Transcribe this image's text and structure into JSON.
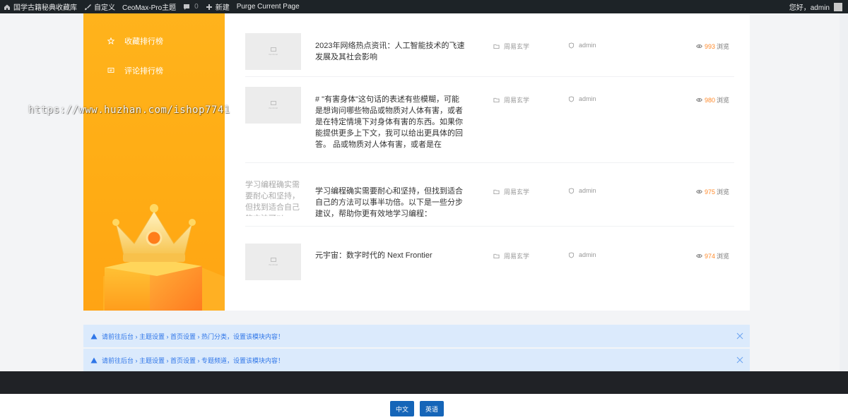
{
  "adminbar": {
    "site_name": "国学古籍秘典收藏库",
    "customize": "自定义",
    "theme": "CeoMax-Pro主题",
    "comments_count": "0",
    "new": "新建",
    "purge": "Purge Current Page",
    "greeting": "您好，admin"
  },
  "rank_panel": {
    "links": [
      "收藏排行榜",
      "评论排行榜"
    ]
  },
  "watermark": "https://www.huzhan.com/ishop7741",
  "posts": [
    {
      "title": "2023年网络热点资讯：人工智能技术的飞速发展及其社会影响",
      "category": "周易玄学",
      "author": "admin",
      "views": "993",
      "views_suffix": "浏览",
      "thumb_label": "thumbnail"
    },
    {
      "title": "# \"有害身体\"这句话的表述有些模糊，可能是想询问哪些物品或物质对人体有害，或者是在特定情境下对身体有害的东西。如果你能提供更多上下文，我可以给出更具体的回答。 品或物质对人体有害，或者是在",
      "category": "周易玄学",
      "author": "admin",
      "views": "980",
      "views_suffix": "浏览",
      "thumb_label": "thumbnail"
    },
    {
      "title": "学习编程确实需要耐心和坚持，但找到适合自己的方法可以事半功倍。以下是一些分步建议，帮助你更有效地学习编程：",
      "category": "周易玄学",
      "author": "admin",
      "views": "975",
      "views_suffix": "浏览",
      "thumb_alt": "学习编程确实需要耐心和坚持，但找到适合自己的方法可以"
    },
    {
      "title": "元宇宙：数字时代的 Next Frontier",
      "category": "周易玄学",
      "author": "admin",
      "views": "974",
      "views_suffix": "浏览",
      "thumb_label": "thumbnail"
    }
  ],
  "notices": [
    "请前往后台 › 主题设置 › 首页设置 › 热门分类，设置该模块内容！",
    "请前往后台 › 主题设置 › 首页设置 › 专题频道，设置该模块内容！"
  ],
  "lang": {
    "zh": "中文",
    "en": "英语"
  },
  "colors": {
    "panel": "#ffb31c",
    "accent": "#ff8b2c",
    "notice_bg": "#dbeafc",
    "notice_text": "#2f76e8",
    "lang_btn": "#1565b8"
  }
}
